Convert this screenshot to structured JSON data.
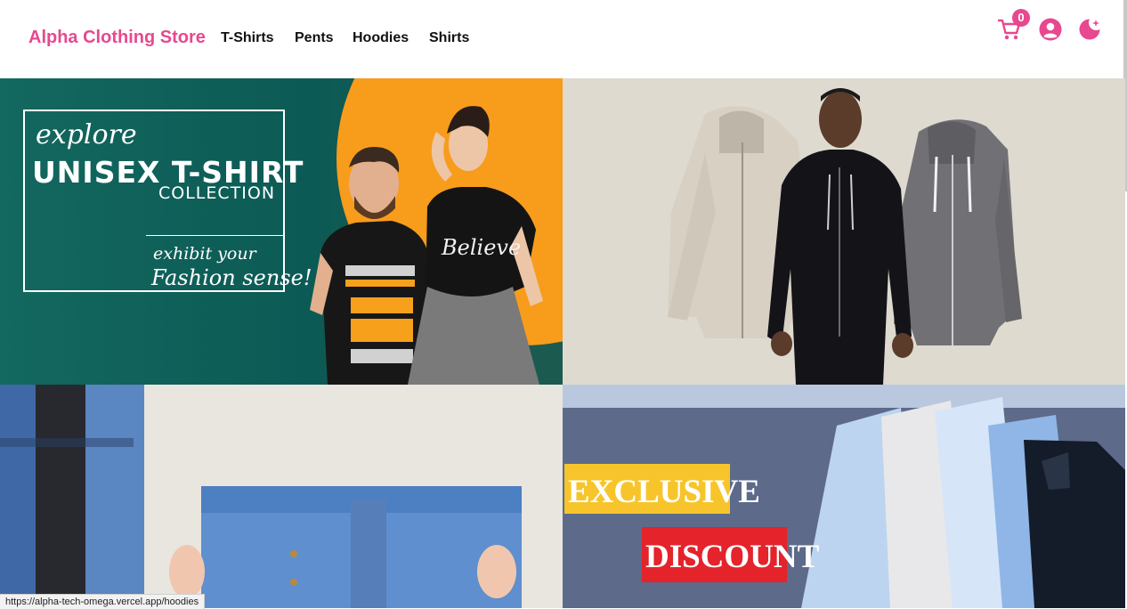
{
  "brand": "Alpha Clothing Store",
  "nav": {
    "links": [
      "T-Shirts",
      "Pents",
      "Hoodies",
      "Shirts"
    ]
  },
  "header_icons": {
    "cart_icon": "cart-icon",
    "cart_count": "0",
    "account_icon": "user-circle-icon",
    "theme_icon": "moon-stars-icon",
    "accent_color": "#e8488f"
  },
  "banners": {
    "tshirt": {
      "explore": "explore",
      "title": "UNISEX T-SHIRT",
      "subtitle": "COLLECTION",
      "tag_line1": "exhibit your",
      "tag_line2": "Fashion sense!",
      "shirt_text_1": "Believe"
    },
    "shirts": {
      "exclusive": "EXCLUSIVE",
      "discount": "DISCOUNT"
    }
  },
  "status_bar": {
    "url": "https://alpha-tech-omega.vercel.app/hoodies"
  }
}
